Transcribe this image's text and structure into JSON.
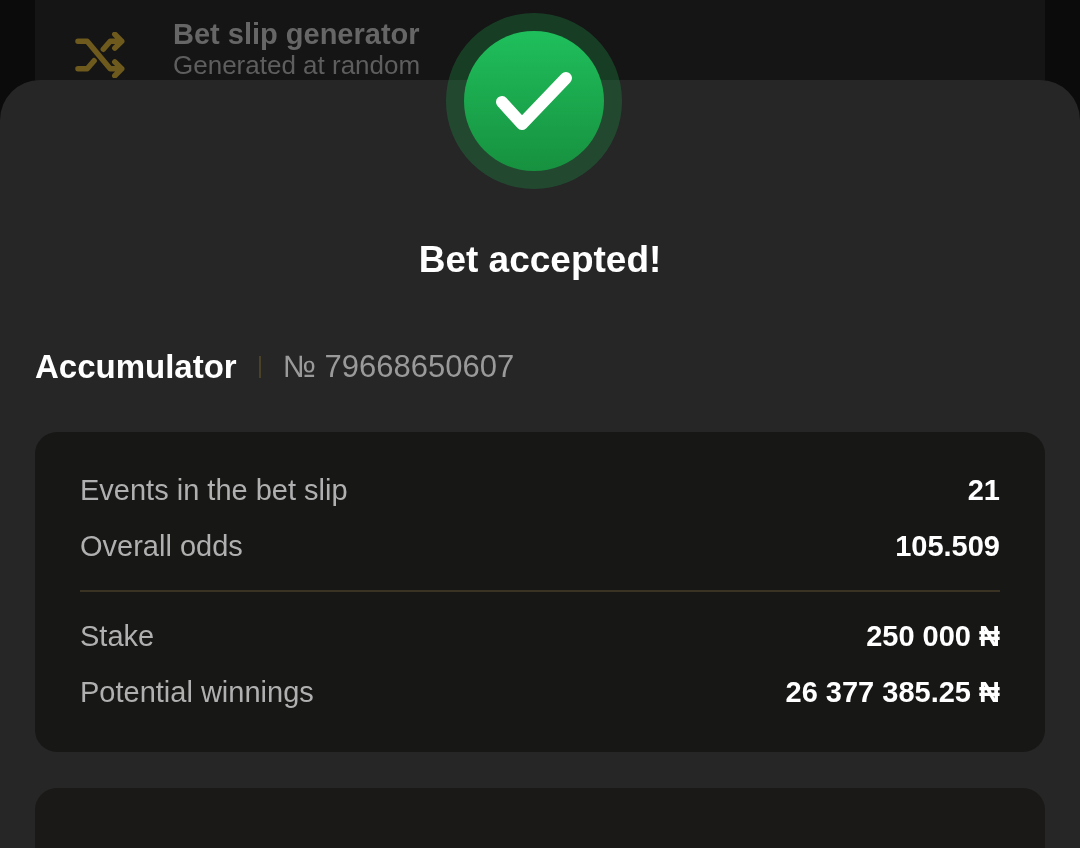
{
  "background_item": {
    "title": "Bet slip generator",
    "subtitle": "Generated at random"
  },
  "dialog": {
    "title": "Bet accepted!",
    "bet_type": "Accumulator",
    "bet_number": "№ 79668650607",
    "summary_groups": [
      [
        {
          "label": "Events in the bet slip",
          "value": "21"
        },
        {
          "label": "Overall odds",
          "value": "105.509"
        }
      ],
      [
        {
          "label": "Stake",
          "value": "250 000 ₦"
        },
        {
          "label": "Potential winnings",
          "value": "26 377 385.25 ₦"
        }
      ]
    ]
  }
}
